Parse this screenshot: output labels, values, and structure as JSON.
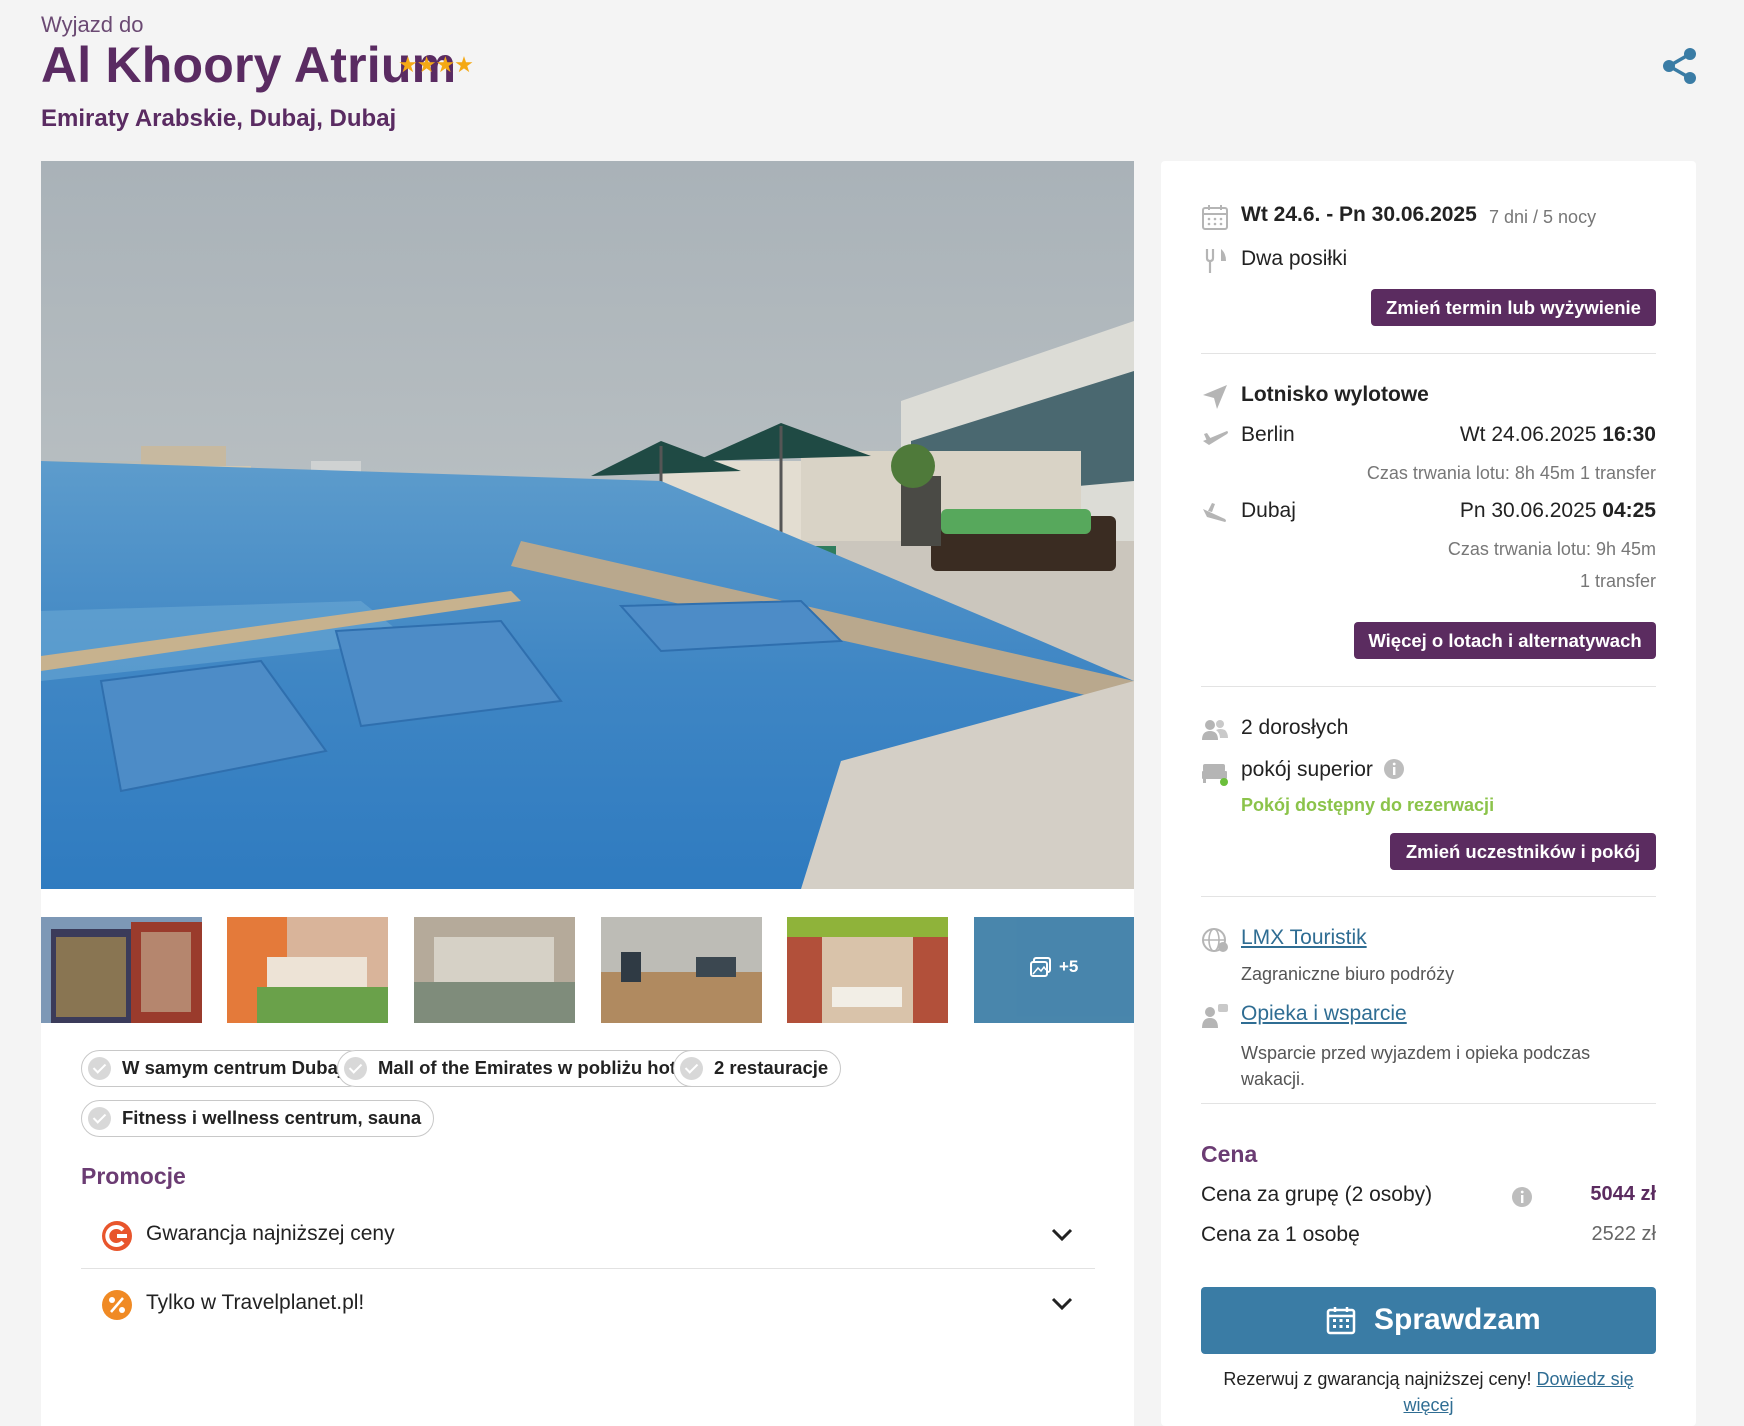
{
  "header": {
    "eyebrow": "Wyjazd do",
    "hotel_name": "Al Khoory Atrium",
    "stars": "★★★★",
    "location": "Emiraty Arabskie, Dubaj, Dubaj"
  },
  "gallery": {
    "more_label": "+5"
  },
  "features": [
    "W samym centrum Dubaju",
    "Mall of the Emirates w pobliżu hotelu",
    "2 restauracje",
    "Fitness i wellness centrum, sauna"
  ],
  "promotions": {
    "title": "Promocje",
    "items": [
      "Gwarancja najniższej ceny",
      "Tylko w Travelplanet.pl!"
    ]
  },
  "booking": {
    "dates": "Wt 24.6. - Pn 30.06.2025",
    "duration": "7 dni / 5 nocy",
    "meal": "Dwa posiłki",
    "change_term_button": "Zmień termin lub wyżywienie",
    "airport_heading": "Lotnisko wylotowe",
    "outbound": {
      "city": "Berlin",
      "date": "Wt 24.06.2025",
      "time": "16:30",
      "info": "Czas trwania lotu: 8h 45m",
      "transfers": "1 transfer"
    },
    "inbound": {
      "city": "Dubaj",
      "date": "Pn 30.06.2025",
      "time": "04:25",
      "info": "Czas trwania lotu: 9h 45m",
      "transfers": "1 transfer"
    },
    "flights_button": "Więcej o lotach i alternatywach",
    "people": "2 dorosłych",
    "room": "pokój superior",
    "room_status": "Pokój dostępny do rezerwacji",
    "change_people_button": "Zmień uczestników i pokój",
    "agency_link": "LMX Touristik",
    "agency_sub": "Zagraniczne biuro podróży",
    "support_link": "Opieka i wsparcie",
    "support_sub": "Wsparcie przed wyjazdem i opieka podczas wakacji.",
    "price_heading": "Cena",
    "price_group_label": "Cena za grupę (2 osoby)",
    "price_group_value": "5044 zł",
    "price_person_label": "Cena za 1 osobę",
    "price_person_value": "2522 zł",
    "check_button": "Sprawdzam",
    "guarantee_text": "Rezerwuj z gwarancją najniższej ceny! ",
    "guarantee_link": "Dowiedz się więcej"
  },
  "colors": {
    "brand_purple": "#5b2c60",
    "link_blue": "#2f6d93",
    "cta_blue": "#3a7ca5",
    "available_green": "#8bc34a",
    "star_gold": "#f4a915"
  }
}
